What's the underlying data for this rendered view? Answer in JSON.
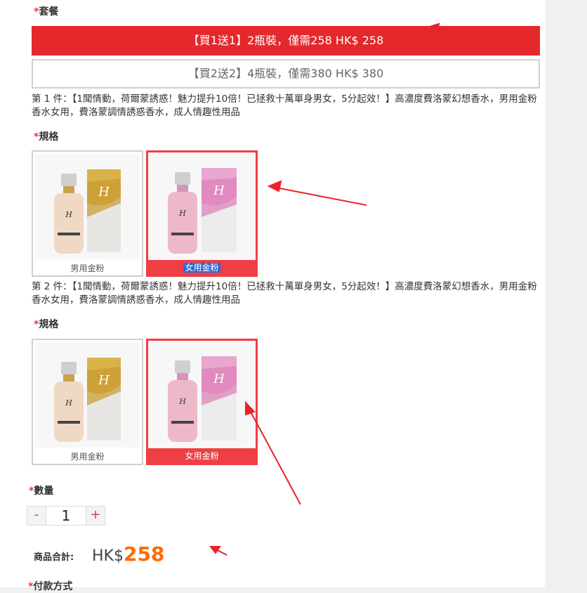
{
  "package": {
    "label": "套餐",
    "options": [
      {
        "label": "【買1送1】2瓶裝，僅需258 HK$ 258",
        "selected": true
      },
      {
        "label": "【買2送2】4瓶裝，僅需380 HK$ 380",
        "selected": false
      }
    ]
  },
  "items": [
    {
      "desc": "第 1 件：【1聞情動，荷爾蒙誘惑！魅力提升10倍！已拯救十萬單身男女，5分起效！】高濃度費洛蒙幻想香水，男用金粉香水女用，費洛蒙調情誘惑香水，成人情趣性用品",
      "spec_label": "規格",
      "specs": [
        {
          "caption": "男用金粉",
          "selected": false,
          "color": "gold"
        },
        {
          "caption": "女用金粉",
          "selected": true,
          "color": "pink"
        }
      ]
    },
    {
      "desc": "第 2 件：【1聞情動，荷爾蒙誘惑！魅力提升10倍！已拯救十萬單身男女，5分起效！】高濃度費洛蒙幻想香水，男用金粉香水女用，費洛蒙調情誘惑香水，成人情趣性用品",
      "spec_label": "規格",
      "specs": [
        {
          "caption": "男用金粉",
          "selected": false,
          "color": "gold"
        },
        {
          "caption": "女用金粉",
          "selected": true,
          "color": "pink"
        }
      ]
    }
  ],
  "quantity": {
    "label": "數量",
    "minus": "-",
    "value": "1",
    "plus": "+"
  },
  "total": {
    "label": "商品合計:",
    "currency": "HK$",
    "amount": "258"
  },
  "payment": {
    "label": "付款方式"
  },
  "required_mark": "*",
  "colors": {
    "accent_red": "#e4282c",
    "selected_card": "#ef3f45",
    "price_orange": "#ff6a00",
    "arrow_red": "#e8232a"
  }
}
